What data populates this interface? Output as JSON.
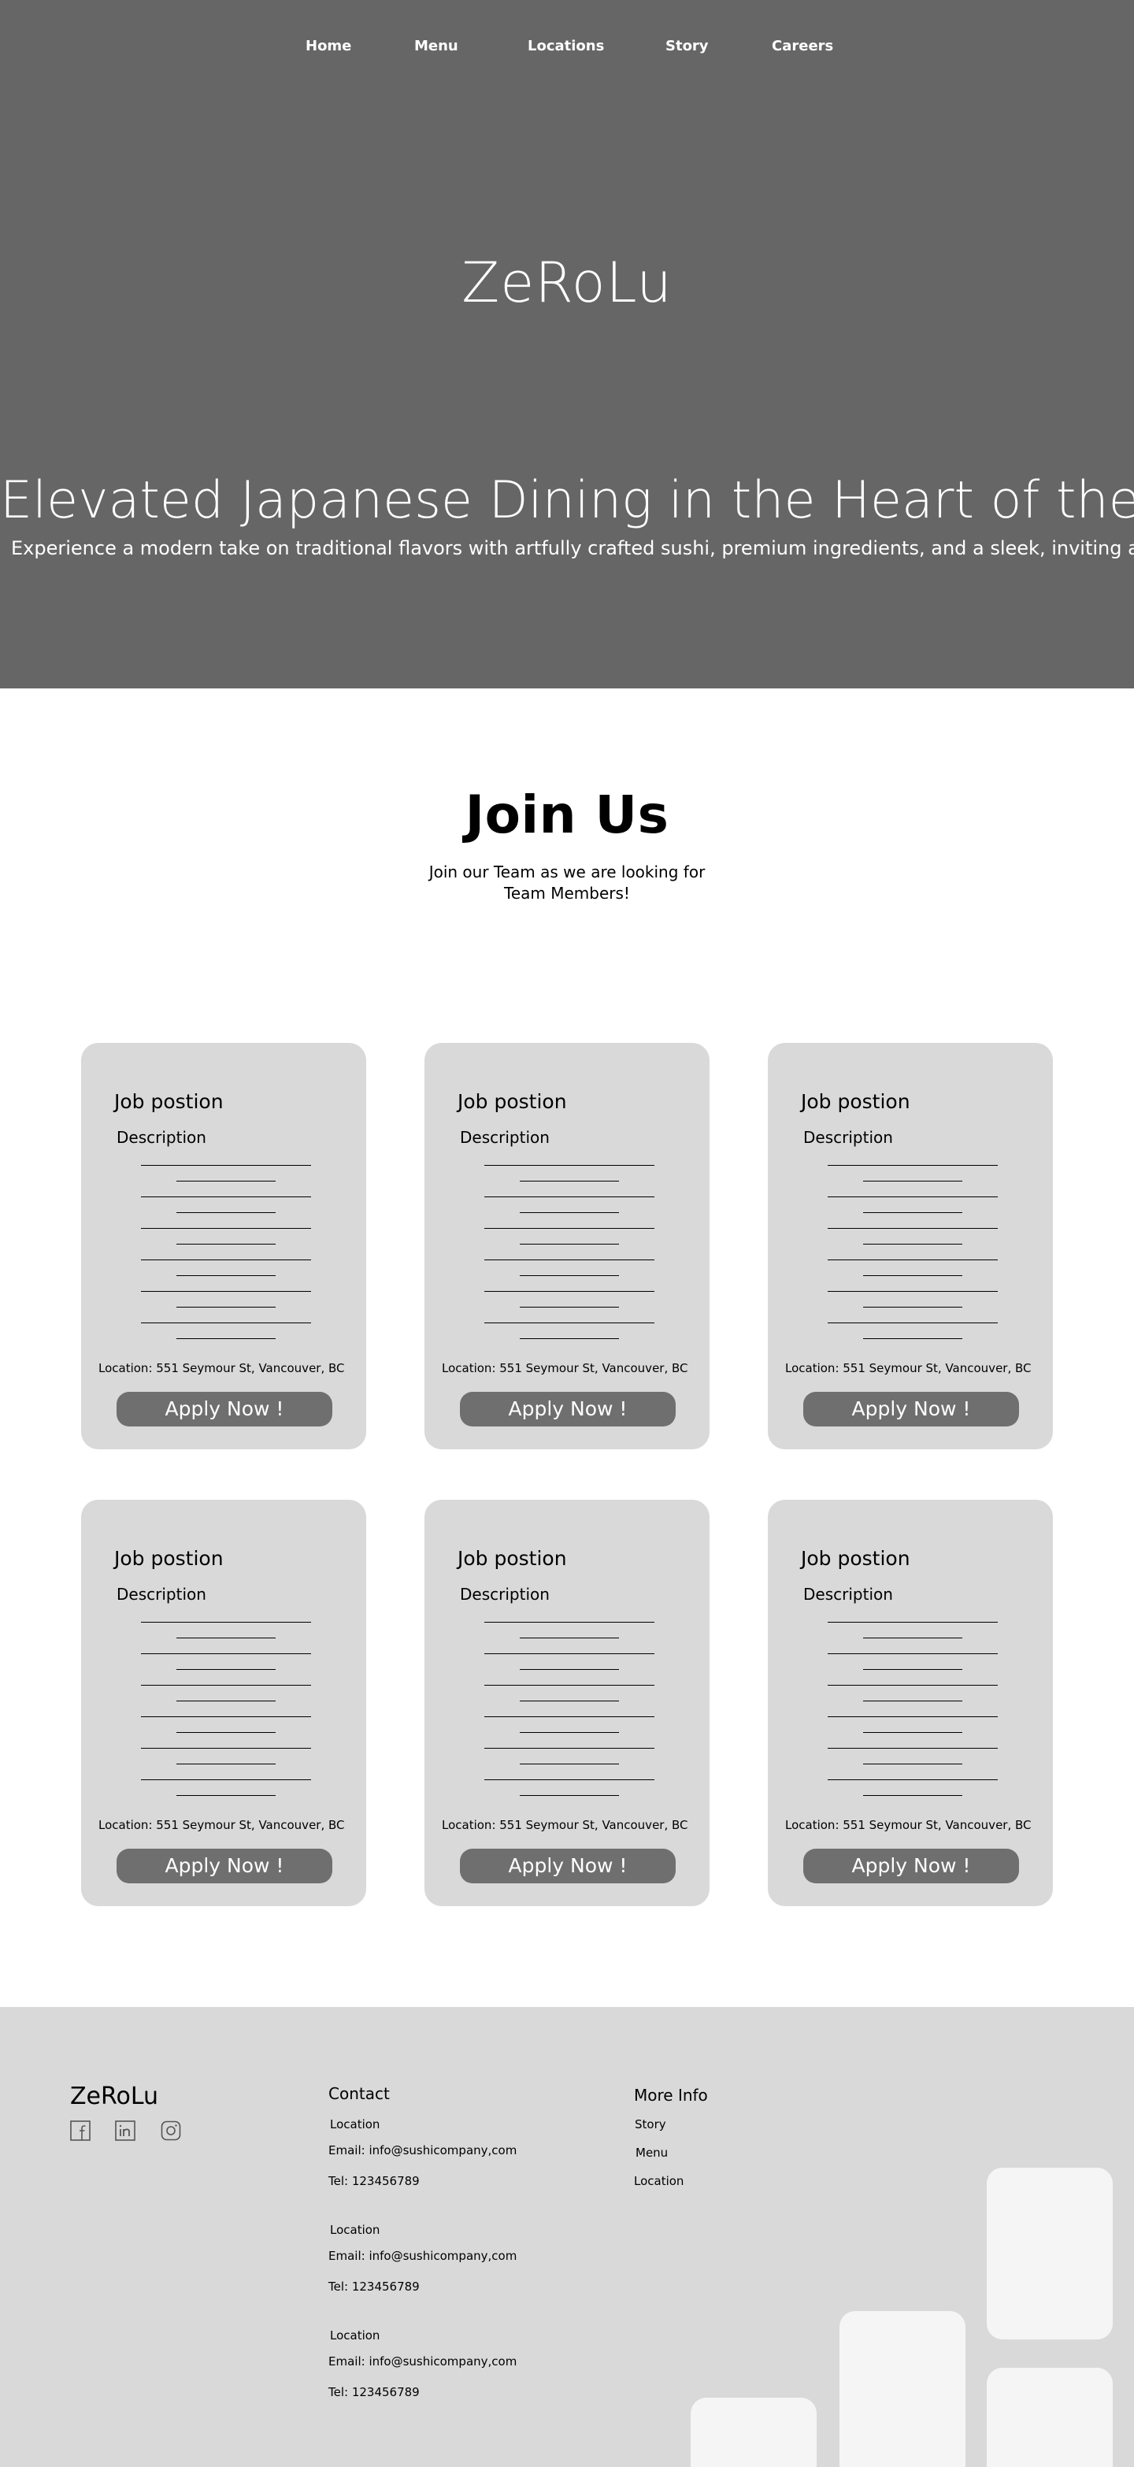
{
  "nav": {
    "items": [
      "Home",
      "Menu",
      "Locations",
      "Story",
      "Careers"
    ]
  },
  "hero": {
    "brand": "ZeRoLu",
    "title": "Elevated Japanese Dining in the Heart of the City",
    "subtitle": "Experience a modern take on traditional flavors with artfully crafted sushi, premium ingredients, and a sleek, inviting atmosphere."
  },
  "join": {
    "title": "Join Us",
    "subtitle": "Join our Team as we are looking for Team Members!"
  },
  "jobs": [
    {
      "title": "Job postion",
      "description_label": "Description",
      "location": "Location:  551 Seymour St, Vancouver, BC",
      "apply": "Apply Now !"
    },
    {
      "title": "Job postion",
      "description_label": "Description",
      "location": "Location:  551 Seymour St, Vancouver, BC",
      "apply": "Apply Now !"
    },
    {
      "title": "Job postion",
      "description_label": "Description",
      "location": "Location:  551 Seymour St, Vancouver, BC",
      "apply": "Apply Now !"
    },
    {
      "title": "Job postion",
      "description_label": "Description",
      "location": "Location:  551 Seymour St, Vancouver, BC",
      "apply": "Apply Now !"
    },
    {
      "title": "Job postion",
      "description_label": "Description",
      "location": "Location:  551 Seymour St, Vancouver, BC",
      "apply": "Apply Now !"
    },
    {
      "title": "Job postion",
      "description_label": "Description",
      "location": "Location:  551 Seymour St, Vancouver, BC",
      "apply": "Apply Now !"
    }
  ],
  "footer": {
    "brand": "ZeRoLu",
    "social_icons": [
      "facebook-icon",
      "linkedin-icon",
      "instagram-icon"
    ],
    "contact": {
      "heading": "Contact",
      "groups": [
        {
          "location": "Location",
          "email": "Email: info@sushicompany,com",
          "tel": "Tel: 123456789"
        },
        {
          "location": "Location",
          "email": "Email: info@sushicompany,com",
          "tel": "Tel: 123456789"
        },
        {
          "location": "Location",
          "email": "Email: info@sushicompany,com",
          "tel": "Tel: 123456789"
        }
      ]
    },
    "more_info": {
      "heading": "More Info",
      "links": [
        "Story",
        "Menu",
        "Location"
      ]
    }
  },
  "colors": {
    "hero_bg": "#666666",
    "card_bg": "#d9d9d9",
    "button_bg": "#6f6f6f",
    "footer_bg": "#d9d9d9",
    "decor_tile": "#f5f5f5"
  }
}
